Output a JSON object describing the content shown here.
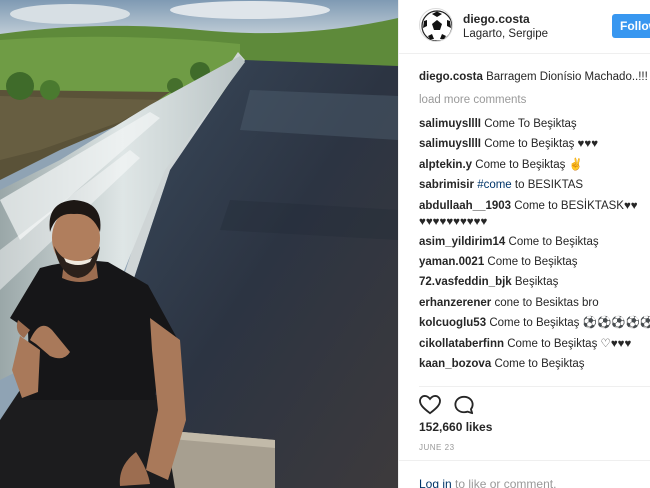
{
  "post": {
    "username": "diego.costa",
    "location": "Lagarto, Sergipe",
    "follow_label": "Follow",
    "caption_user": "diego.costa",
    "caption_text": "Barragem Dionísio Machado..!!!",
    "load_more": "load more comments",
    "likes": "152,660 likes",
    "date": "JUNE 23"
  },
  "comments": [
    {
      "user": "salimuyslllI",
      "text": "Come To Beşiktaş"
    },
    {
      "user": "salimuyslllI",
      "text": "Come to Beşiktaş ♥♥♥"
    },
    {
      "user": "alptekin.y",
      "text": "Come to Beşiktaş ✌"
    },
    {
      "user": "sabrimisir",
      "hashtag": "#come",
      "text": "to BESIKTAS"
    },
    {
      "user": "abdullaah__1903",
      "text": "Come to BESİKTASK♥♥ ♥♥♥♥♥♥♥♥♥♥"
    },
    {
      "user": "asim_yildirim14",
      "text": "Come to Beşiktaş"
    },
    {
      "user": "yaman.0021",
      "text": "Come to Beşiktaş"
    },
    {
      "user": "72.vasfeddin_bjk",
      "text": "Beşiktaş"
    },
    {
      "user": "erhanzerener",
      "text": "cone to Besiktas bro"
    },
    {
      "user": "kolcuoglu53",
      "text": "Come to Beşiktaş ⚽⚽⚽⚽⚽⚽"
    },
    {
      "user": "cikollataberfinn",
      "text": "Come to Beşiktaş ♡♥♥♥"
    },
    {
      "user": "kaan_bozova",
      "text": "Come to Beşiktaş"
    }
  ],
  "footer": {
    "login_link": "Log in",
    "login_rest": "to like or comment."
  },
  "icons": {
    "heart": "heart-icon",
    "comment": "comment-icon",
    "avatar": "soccer-ball-avatar"
  },
  "colors": {
    "accent": "#3897f0",
    "link": "#003569",
    "muted": "#999999"
  }
}
